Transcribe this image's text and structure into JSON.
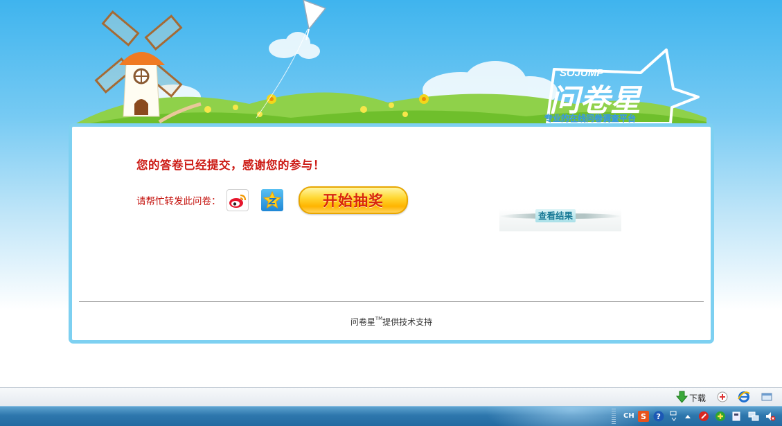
{
  "banner": {
    "brand_en": "SOJUMP",
    "brand_cn": "问卷星",
    "slogan": "专业的在线问卷调查平台"
  },
  "card": {
    "thanks_message": "您的答卷已经提交，感谢您的参与！",
    "share_label": "请帮忙转发此问卷：",
    "share_icons": [
      "weibo-icon",
      "qzone-icon"
    ],
    "lottery_label": "开始抽奖",
    "results_label": "查看结果",
    "footer_brand": "问卷星",
    "footer_tm": "TM",
    "footer_support": "提供技术支持"
  },
  "status_bar": {
    "download_label": "下载",
    "icons": [
      "download-arrow-icon",
      "add-tab-icon",
      "ie-logo-icon",
      "window-icon"
    ]
  },
  "taskbar": {
    "lang_indicator": "CH",
    "tray_icons": [
      "sogou-ime-icon",
      "help-icon",
      "ime-settings-icon",
      "show-hidden-icon",
      "red-app-icon",
      "green-plus-icon",
      "device-icon",
      "network-icon",
      "volume-muted-icon"
    ]
  },
  "colors": {
    "sky_top": "#3fb4ee",
    "card_border": "#7dd0f1",
    "thanks_red": "#cc1a14",
    "lottery_gold": "#ffd834",
    "results_teal": "#197a96"
  }
}
